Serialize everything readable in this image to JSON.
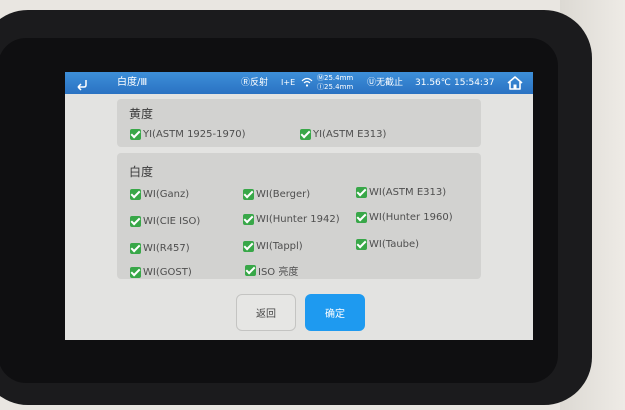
{
  "statusbar": {
    "title": "白度/Ⅲ",
    "mode": "Ⓡ反射",
    "lamp": "I+E",
    "aperture_top": "Ⓜ25.4mm",
    "aperture_bottom": "Ⓘ25.4mm",
    "uv": "Ⓤ无截止",
    "temperature": "31.56℃",
    "time": "15:54:37"
  },
  "yellowness": {
    "title": "黄度",
    "options": [
      {
        "label": "YI(ASTM 1925-1970)",
        "checked": true
      },
      {
        "label": "YI(ASTM E313)",
        "checked": true
      }
    ]
  },
  "whiteness": {
    "title": "白度",
    "options": [
      {
        "label": "WI(Ganz)",
        "checked": true
      },
      {
        "label": "WI(Berger)",
        "checked": true
      },
      {
        "label": "WI(ASTM E313)",
        "checked": true
      },
      {
        "label": "WI(CIE ISO)",
        "checked": true
      },
      {
        "label": "WI(Hunter 1942)",
        "checked": true
      },
      {
        "label": "WI(Hunter 1960)",
        "checked": true
      },
      {
        "label": "WI(R457)",
        "checked": true
      },
      {
        "label": "WI(Tappl)",
        "checked": true
      },
      {
        "label": "WI(Taube)",
        "checked": true
      },
      {
        "label": "WI(GOST)",
        "checked": true
      },
      {
        "label": "ISO 亮度",
        "checked": true
      }
    ]
  },
  "buttons": {
    "back": "返回",
    "confirm": "确定"
  },
  "colors": {
    "accent": "#1e9af0",
    "statusbar": "#2a72c2",
    "checkbox": "#38a748"
  }
}
